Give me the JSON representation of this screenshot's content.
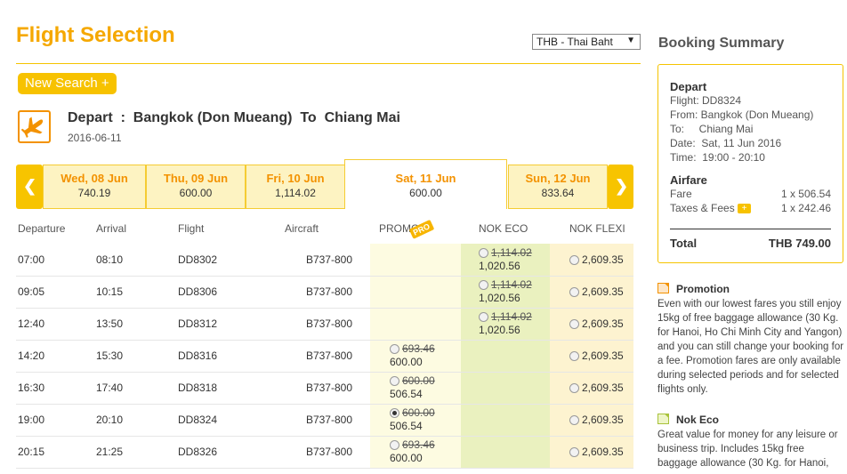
{
  "page": {
    "title": "Flight Selection",
    "currency": "THB - Thai Baht",
    "new_search": "New Search"
  },
  "route": {
    "label": "Depart  :  Bangkok (Don Mueang)  To  Chiang Mai",
    "date": "2016-06-11"
  },
  "dates": [
    {
      "day": "Wed, 08 Jun",
      "price": "740.19"
    },
    {
      "day": "Thu, 09 Jun",
      "price": "600.00"
    },
    {
      "day": "Fri, 10 Jun",
      "price": "1,114.02"
    },
    {
      "day": "Sat, 11 Jun",
      "price": "600.00"
    },
    {
      "day": "Sun, 12 Jun",
      "price": "833.64"
    }
  ],
  "table": {
    "headers": [
      "Departure",
      "Arrival",
      "Flight",
      "Aircraft",
      "PROMO",
      "NOK ECO",
      "NOK FLEXI"
    ],
    "promo_tag": "PRO",
    "rows": [
      {
        "dep": "07:00",
        "arr": "08:10",
        "flight": "DD8302",
        "aircraft": "B737-800",
        "promo_old": "",
        "promo_new": "",
        "eco_old": "1,114.02",
        "eco_new": "1,020.56",
        "flexi": "2,609.35"
      },
      {
        "dep": "09:05",
        "arr": "10:15",
        "flight": "DD8306",
        "aircraft": "B737-800",
        "promo_old": "",
        "promo_new": "",
        "eco_old": "1,114.02",
        "eco_new": "1,020.56",
        "flexi": "2,609.35"
      },
      {
        "dep": "12:40",
        "arr": "13:50",
        "flight": "DD8312",
        "aircraft": "B737-800",
        "promo_old": "",
        "promo_new": "",
        "eco_old": "1,114.02",
        "eco_new": "1,020.56",
        "flexi": "2,609.35"
      },
      {
        "dep": "14:20",
        "arr": "15:30",
        "flight": "DD8316",
        "aircraft": "B737-800",
        "promo_old": "693.46",
        "promo_new": "600.00",
        "eco_old": "",
        "eco_new": "",
        "flexi": "2,609.35"
      },
      {
        "dep": "16:30",
        "arr": "17:40",
        "flight": "DD8318",
        "aircraft": "B737-800",
        "promo_old": "600.00",
        "promo_new": "506.54",
        "eco_old": "",
        "eco_new": "",
        "flexi": "2,609.35"
      },
      {
        "dep": "19:00",
        "arr": "20:10",
        "flight": "DD8324",
        "aircraft": "B737-800",
        "promo_old": "600.00",
        "promo_new": "506.54",
        "eco_old": "",
        "eco_new": "",
        "flexi": "2,609.35",
        "selected": "promo"
      },
      {
        "dep": "20:15",
        "arr": "21:25",
        "flight": "DD8326",
        "aircraft": "B737-800",
        "promo_old": "693.46",
        "promo_new": "600.00",
        "eco_old": "",
        "eco_new": "",
        "flexi": "2,609.35"
      }
    ]
  },
  "summary": {
    "title": "Booking Summary",
    "depart_head": "Depart",
    "flight": "Flight: DD8324",
    "from": "From: Bangkok (Don Mueang)",
    "to": "To:     Chiang Mai",
    "date": "Date:  Sat, 11 Jun 2016",
    "time": "Time:  19:00 - 20:10",
    "airfare_head": "Airfare",
    "fare_label": "Fare",
    "fare_value": "1 x 506.54",
    "taxes_label": "Taxes & Fees",
    "taxes_value": "1 x 242.46",
    "total_label": "Total",
    "total_value": "THB 749.00"
  },
  "info": {
    "promo_title": "Promotion",
    "promo_text": "Even with our lowest fares you still enjoy 15kg of free baggage allowance (30 Kg. for Hanoi, Ho Chi Minh City and Yangon) and you can still change your booking for a fee. Promotion fares are only available during selected periods and for selected flights only.",
    "eco_title": "Nok Eco",
    "eco_text": "Great value for money for any leisure or business trip. Includes 15kg free baggage allowance (30 Kg. for Hanoi,"
  },
  "colors": {
    "accent": "#f5a800",
    "eco": "#c8dc6a",
    "flexi": "#fbc880"
  }
}
